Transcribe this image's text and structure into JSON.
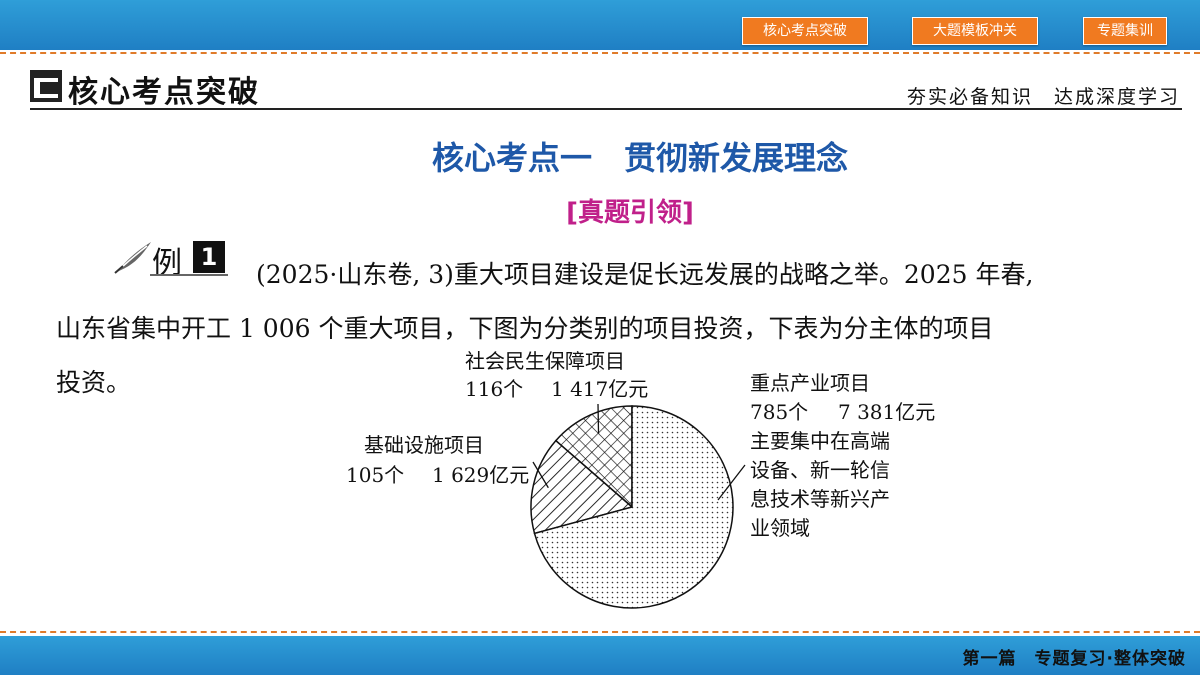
{
  "nav": {
    "buttons": [
      "核心考点突破",
      "大题模板冲关",
      "专题集训"
    ]
  },
  "section": {
    "title": "核心考点突破",
    "right": "夯实必备知识　达成深度学习"
  },
  "heading": "核心考点一　贯彻新发展理念",
  "subheading": "[真题引领]",
  "example": {
    "label": "例",
    "number": "1",
    "line1": "(2025·山东卷, 3)重大项目建设是促长远发展的战略之举。2025 年春,",
    "line2": "山东省集中开工 1 006 个重大项目，下图为分类别的项目投资，下表为分主体的项目",
    "line3": "投资。"
  },
  "chart_data": {
    "type": "pie",
    "unit": "亿元",
    "slices": [
      {
        "name": "重点产业项目",
        "count": "785个",
        "value": 7381,
        "value_label": "7 381亿元",
        "note": [
          "主要集中在高端",
          "设备、新一轮信",
          "息技术等新兴产",
          "业领域"
        ],
        "pattern": "dots"
      },
      {
        "name": "基础设施项目",
        "count": "105个",
        "value": 1629,
        "value_label": "1 629亿元",
        "pattern": "hatch"
      },
      {
        "name": "社会民生保障项目",
        "count": "116个",
        "value": 1417,
        "value_label": "1 417亿元",
        "pattern": "cross"
      }
    ]
  },
  "footer": "第一篇　专题复习·整体突破",
  "colors": {
    "bar": "#2f9ed8",
    "nav_button": "#f07a20",
    "heading": "#1e58a8",
    "subheading": "#c0208a",
    "dash": "#e07b2a"
  }
}
